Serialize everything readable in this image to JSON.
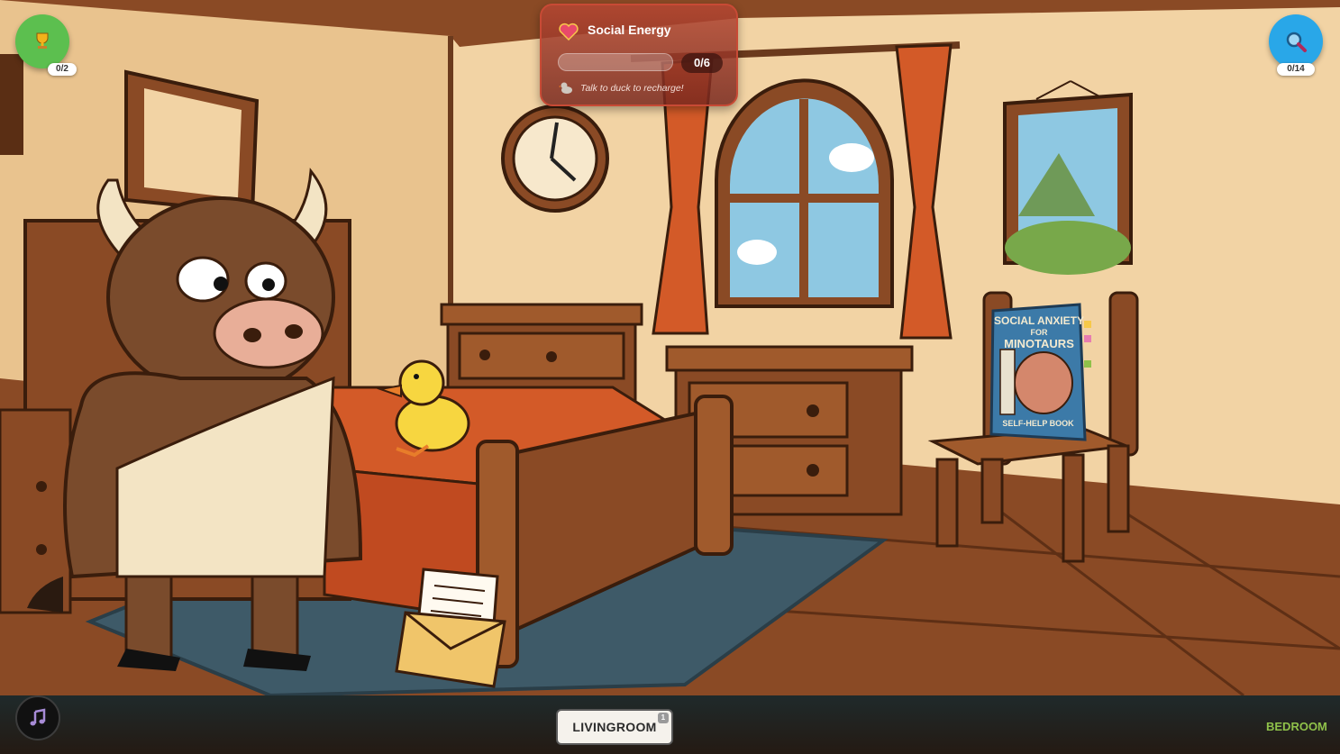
{
  "hud": {
    "trophy_count": "0/2",
    "search_count": "0/14"
  },
  "energy": {
    "title": "Social Energy",
    "value": "0/6",
    "current": 0,
    "max": 6,
    "hint": "Talk to duck to recharge!"
  },
  "book": {
    "line1": "SOCIAL ANXIETY",
    "line2": "FOR",
    "line3": "MINOTAURS",
    "subtitle": "SELF-HELP BOOK"
  },
  "nav": {
    "living_room_label": "LIVINGROOM",
    "living_room_badge": "1",
    "current_room": "BEDROOM"
  },
  "colors": {
    "wall": "#f2d3a4",
    "floor": "#8a4a25",
    "energy_panel": "#b4463a",
    "trophy": "#5cbf4f",
    "search": "#29a7e8",
    "current_room": "#8fc14a"
  },
  "icons": [
    "trophy-icon",
    "magnifier-icon",
    "heart-icon",
    "music-note-icon",
    "duck-icon"
  ]
}
